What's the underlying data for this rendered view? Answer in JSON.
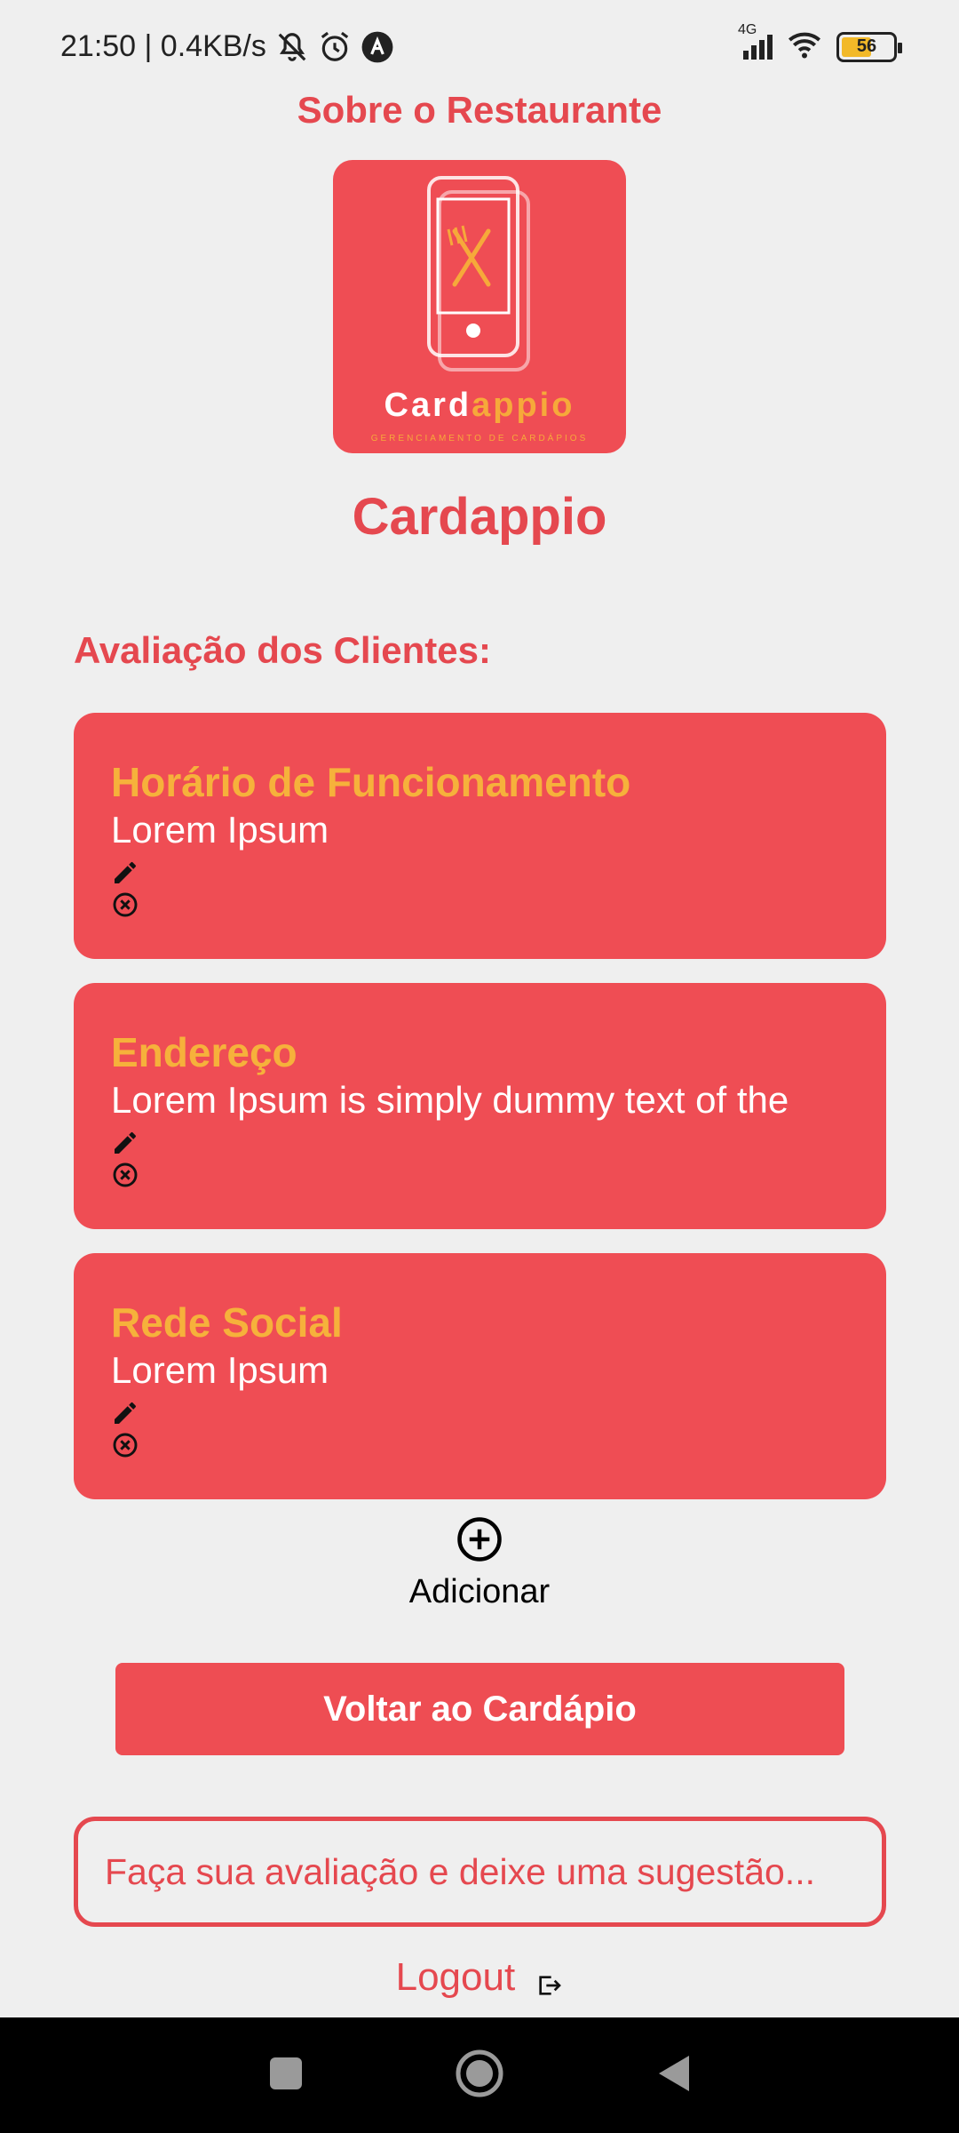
{
  "status_bar": {
    "time_speed": "21:50 | 0.4KB/s",
    "network": "4G",
    "battery": "56",
    "icons": [
      "bell-off-icon",
      "alarm-icon",
      "app-a-icon",
      "signal-icon",
      "wifi-icon",
      "battery-icon"
    ]
  },
  "header": {
    "title": "Sobre o Restaurante"
  },
  "logo": {
    "brand_main": "Card",
    "brand_accent": "appio",
    "tagline": "GERENCIAMENTO DE CARDÁPIOS"
  },
  "restaurant": {
    "name": "Cardappio"
  },
  "reviews": {
    "label": "Avaliação dos Clientes:",
    "items": [
      {
        "title": "Horário de Funcionamento",
        "body": "Lorem Ipsum"
      },
      {
        "title": "Endereço",
        "body": "Lorem Ipsum is simply dummy text of the"
      },
      {
        "title": "Rede Social",
        "body": "Lorem Ipsum"
      }
    ]
  },
  "add": {
    "label": "Adicionar"
  },
  "back_button": {
    "label": "Voltar ao Cardápio"
  },
  "feedback": {
    "placeholder": "Faça sua avaliação e deixe uma sugestão..."
  },
  "logout": {
    "label": "Logout"
  },
  "colors": {
    "accent_red": "#e5484f",
    "card_red": "#ef4d54",
    "title_orange": "#f6b13b",
    "background": "#efefef"
  }
}
